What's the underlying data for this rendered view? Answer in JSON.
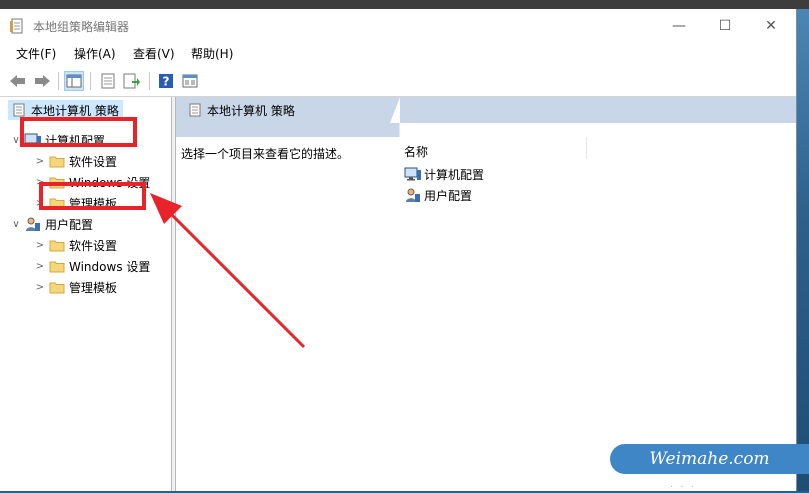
{
  "window": {
    "title": "本地组策略编辑器",
    "minimize_glyph": "—",
    "maximize_glyph": "☐",
    "close_glyph": "✕"
  },
  "menu": {
    "file": "文件(F)",
    "action": "操作(A)",
    "view": "查看(V)",
    "help": "帮助(H)"
  },
  "toolbar": {
    "icons": [
      "back-arrow-icon",
      "forward-arrow-icon",
      "show-tree-icon",
      "properties-icon",
      "export-list-icon",
      "help-icon",
      "extended-view-icon"
    ]
  },
  "tree": {
    "root": "本地计算机 策略",
    "computer_config": {
      "label": "计算机配置",
      "children": [
        "软件设置",
        "Windows 设置",
        "管理模板"
      ]
    },
    "user_config": {
      "label": "用户配置",
      "children": [
        "软件设置",
        "Windows 设置",
        "管理模板"
      ]
    }
  },
  "right_pane": {
    "header": "本地计算机 策略",
    "description": "选择一个项目来查看它的描述。",
    "column_name": "名称",
    "items": [
      "计算机配置",
      "用户配置"
    ]
  },
  "colors": {
    "highlight": "#e8232a",
    "header_bar": "#c9d6e8",
    "selection": "#cce8ff",
    "watermark_bg": "#3f86c6"
  },
  "watermark": {
    "text": "Weimahe.com",
    "dots": "· · ·"
  }
}
